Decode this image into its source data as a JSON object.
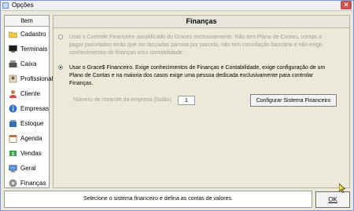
{
  "window": {
    "title": "Opções",
    "close_symbol": "✕"
  },
  "sidebar": {
    "header": "Item",
    "items": [
      {
        "label": "Cadastro",
        "icon": "folder-icon"
      },
      {
        "label": "Terminais",
        "icon": "terminal-icon"
      },
      {
        "label": "Caixa",
        "icon": "cash-register-icon"
      },
      {
        "label": "Profissional",
        "icon": "professional-icon"
      },
      {
        "label": "Cliente",
        "icon": "client-icon"
      },
      {
        "label": "Empresas",
        "icon": "info-icon"
      },
      {
        "label": "Estoque",
        "icon": "stock-icon"
      },
      {
        "label": "Agenda",
        "icon": "calendar-icon"
      },
      {
        "label": "Vendas",
        "icon": "sales-icon"
      },
      {
        "label": "Geral",
        "icon": "general-icon"
      },
      {
        "label": "Finanças",
        "icon": "finance-icon"
      }
    ]
  },
  "panel": {
    "title": "Finanças",
    "option_simple": "Usar o Controle Financeiro simplificado do Graces exclusivamente. Não tem Plano de Contas, contas a pagar parceladas terão que ser lançadas parcela por parcela, não tem conciliação bancária e não exige conhecimentos de finanças e/ou contabilidade.",
    "option_full": "Usar o Grace$ Financeiro. Exige conhecimentos de Finanças e Contabilidade, exige configuração de um Plano de Contas e na maioria dos casos exige uma pessoa dedicada exclusivamente para controlar Finanças.",
    "company_label": "Número de controle da empresa (Salão)",
    "company_value": "1",
    "config_button": "Configurar Sistema Financeiro"
  },
  "footer": {
    "status": "Selecione o sistema financeiro e defina as contas de valores.",
    "ok_button": "OK"
  }
}
